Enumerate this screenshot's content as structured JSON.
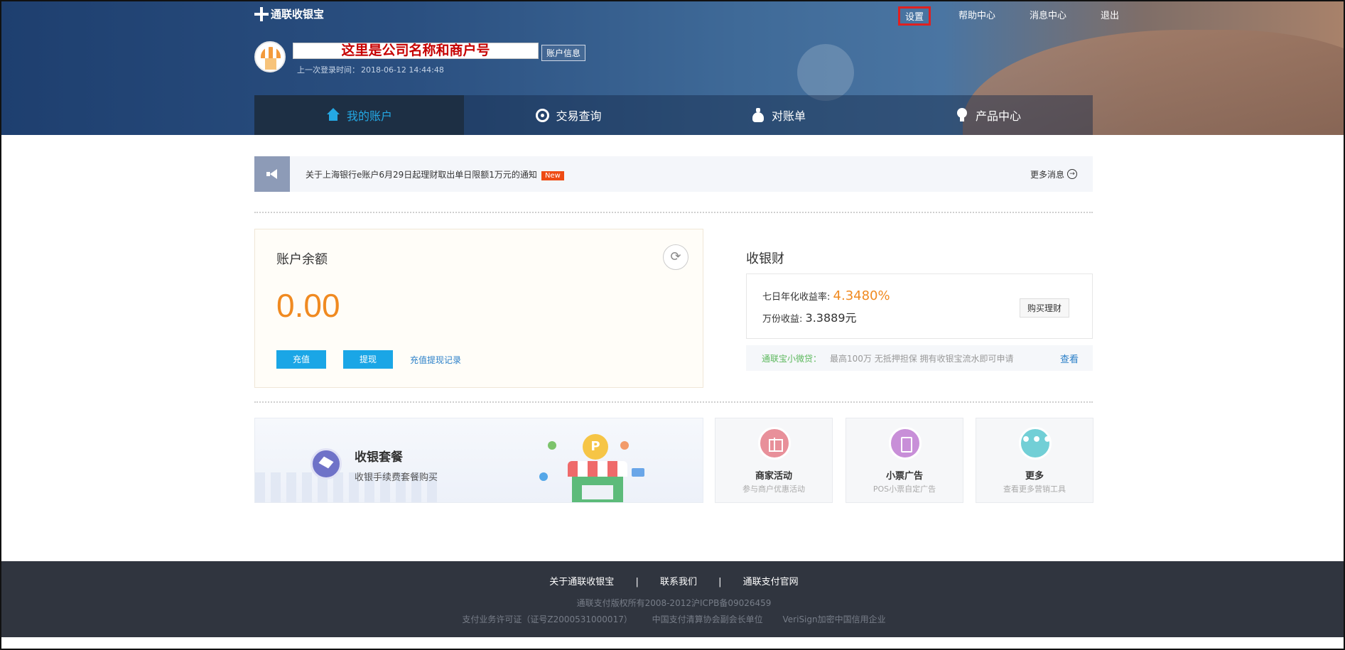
{
  "header": {
    "logo_text": "通联收银宝",
    "top_nav": [
      "设置",
      "帮助中心",
      "消息中心",
      "退出"
    ],
    "company_placeholder": "这里是公司名称和商户号",
    "account_info_button": "账户信息",
    "last_login_label": "上一次登录时间：",
    "last_login_time": "2018-06-12 14:44:48"
  },
  "main_nav": [
    {
      "label": "我的账户",
      "icon": "home-icon",
      "active": true
    },
    {
      "label": "交易查询",
      "icon": "query-icon",
      "active": false
    },
    {
      "label": "对账单",
      "icon": "bill-icon",
      "active": false
    },
    {
      "label": "产品中心",
      "icon": "bulb-icon",
      "active": false
    }
  ],
  "notice": {
    "text": "关于上海银行e账户6月29日起理财取出单日限额1万元的通知",
    "badge": "New",
    "more_label": "更多消息"
  },
  "balance": {
    "title": "账户余额",
    "amount": "0.00",
    "recharge_button": "充值",
    "withdraw_button": "提现",
    "record_link": "充值提现记录"
  },
  "shouyincai": {
    "title": "收银财",
    "yield_label": "七日年化收益率:",
    "yield_value": "4.3480%",
    "per_10k_label": "万份收益:",
    "per_10k_value": "3.3889元",
    "buy_button": "购买理财",
    "loan_name": "通联宝小微贷：",
    "loan_desc": "最高100万 无抵押担保 拥有收银宝流水即可申请",
    "loan_link": "查看"
  },
  "package_card": {
    "title": "收银套餐",
    "subtitle": "收银手续费套餐购买",
    "coin_symbol": "P"
  },
  "mini_cards": [
    {
      "title": "商家活动",
      "subtitle": "参与商户优惠活动",
      "icon": "gift-icon",
      "color": "#e8909a"
    },
    {
      "title": "小票广告",
      "subtitle": "POS小票自定广告",
      "icon": "ticket-icon",
      "color": "#c88fd8"
    },
    {
      "title": "更多",
      "subtitle": "查看更多营销工具",
      "icon": "more-icon",
      "color": "#72cfd6"
    }
  ],
  "footer": {
    "links": [
      "关于通联收银宝",
      "联系我们",
      "通联支付官网"
    ],
    "separator": "|",
    "copyright": "通联支付版权所有2008-2012沪ICPB备09026459",
    "certs": [
      "支付业务许可证（证号Z2000531000017）",
      "中国支付清算协会副会长单位",
      "VeriSign加密中国信用企业"
    ]
  }
}
